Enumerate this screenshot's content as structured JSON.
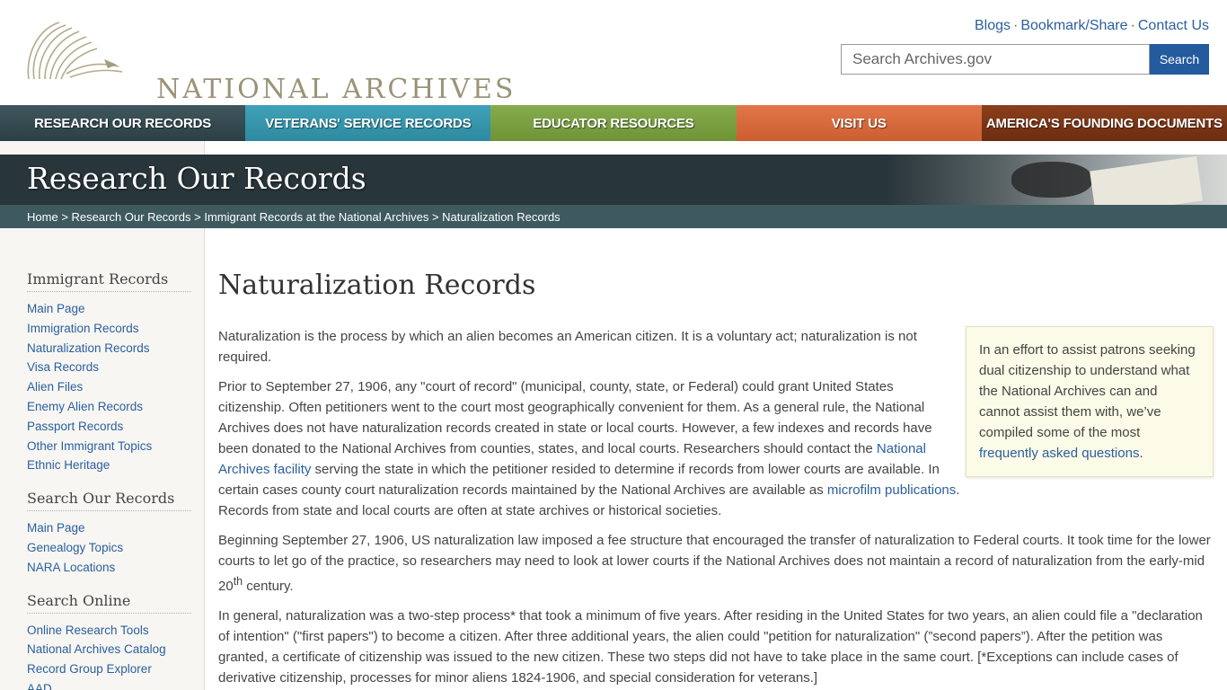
{
  "header": {
    "logo_text": "NATIONAL ARCHIVES",
    "util_links": [
      "Blogs",
      "Bookmark/Share",
      "Contact Us"
    ],
    "util_separator": "·",
    "search_placeholder": "Search Archives.gov",
    "search_button": "Search"
  },
  "nav": {
    "items": [
      "Research Our Records",
      "Veterans' Service Records",
      "Educator Resources",
      "Visit Us",
      "America's Founding Documents"
    ]
  },
  "banner": {
    "title": "Research Our Records"
  },
  "breadcrumb": {
    "items": [
      "Home",
      "Research Our Records",
      "Immigrant Records at the National Archives",
      "Naturalization Records"
    ],
    "separator": ">"
  },
  "sidebar": {
    "sections": [
      {
        "heading": "Immigrant Records",
        "links": [
          "Main Page",
          "Immigration Records",
          "Naturalization Records",
          "Visa Records",
          "Alien Files",
          "Enemy Alien Records",
          "Passport Records",
          "Other Immigrant Topics",
          "Ethnic Heritage"
        ]
      },
      {
        "heading": "Search Our Records",
        "links": [
          "Main Page",
          "Genealogy Topics",
          "NARA Locations"
        ]
      },
      {
        "heading": "Search Online",
        "links": [
          "Online Research Tools",
          "National Archives Catalog",
          "Record Group Explorer",
          "AAD"
        ]
      }
    ]
  },
  "main": {
    "title": "Naturalization Records",
    "p1": "Naturalization is the process by which an alien becomes an American citizen. It is a voluntary act; naturalization is not required.",
    "p2_a": "Prior to September 27, 1906, any \"court of record\" (municipal, county, state, or Federal) could grant United States citizenship. Often petitioners went to the court most geographically convenient for them. As a general rule, the National Archives does not have naturalization records created in state or local courts. However, a few indexes and records have been donated to the National Archives from counties, states, and local courts. Researchers should contact the ",
    "p2_link1": "National Archives facility",
    "p2_b": " serving the state in which the petitioner resided to determine if records from lower courts are available. In certain cases county court naturalization records maintained by the National Archives are available as ",
    "p2_link2": "microfilm publications",
    "p2_c": ". Records from state and local courts are often at state archives or historical societies.",
    "p3_a": "Beginning September 27, 1906, US naturalization law imposed a fee structure that encouraged the transfer of naturalization to Federal courts. It took time for the lower courts to let go of the practice, so researchers may need to look at lower courts if the National Archives does not maintain a record of naturalization from the early-mid 20",
    "p3_sup": "th",
    "p3_b": " century.",
    "p4": "In general, naturalization was a two-step process* that took a minimum of five years. After residing in the United States for two years, an alien could file a \"declaration of intention\" (\"first papers\") to become a citizen. After three additional years, the alien could \"petition for naturalization\" (”second papers”). After the petition was granted, a certificate of citizenship was issued to the new citizen. These two steps did not have to take place in the same court.  [*Exceptions can include cases of derivative citizenship, processes for minor aliens 1824-1906, and special consideration for veterans.]"
  },
  "callout": {
    "text": "In an effort to assist patrons seeking dual citizenship to understand what the National Archives can and cannot assist them with, we’ve compiled some of the most ",
    "link": "frequently asked questions",
    "end": "."
  }
}
